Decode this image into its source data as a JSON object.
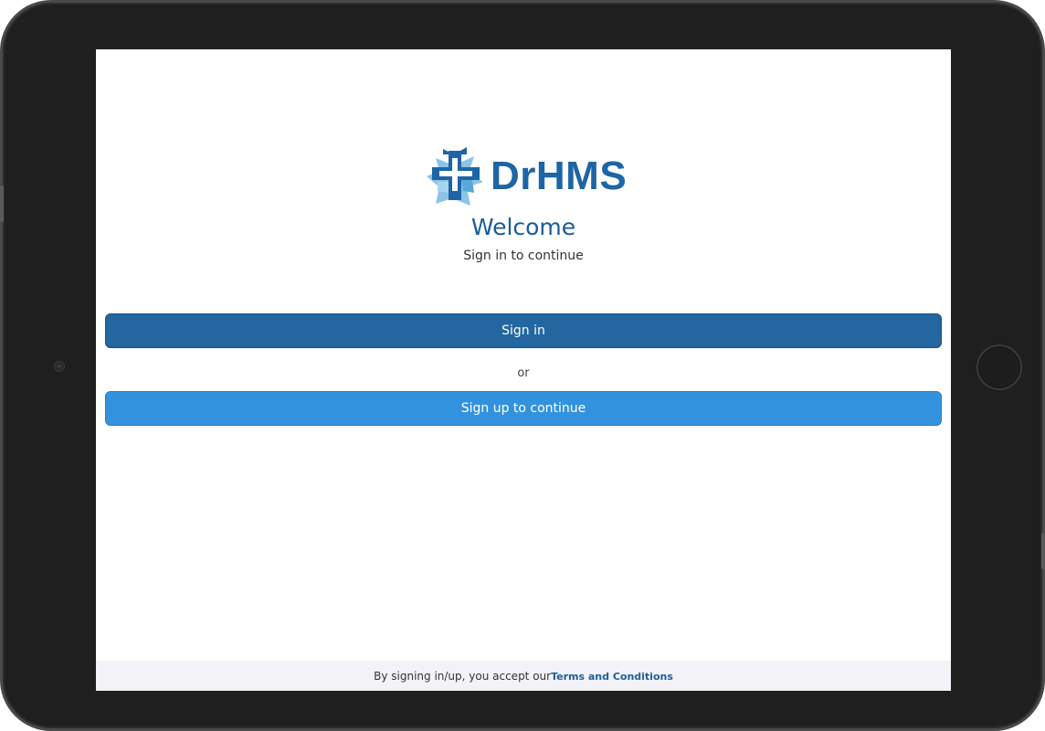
{
  "app": {
    "logo_text": "DrHMS"
  },
  "header": {
    "title": "Welcome",
    "subtitle": "Sign in to continue"
  },
  "actions": {
    "sign_in_label": "Sign in",
    "separator_label": "or",
    "sign_up_label": "Sign up to continue"
  },
  "footer": {
    "text": "By signing in/up, you accept our",
    "terms_link_label": "Terms and Conditions"
  },
  "colors": {
    "brand_dark": "#1e65a6",
    "brand_light": "#8cc4e6",
    "sign_in_button": "#2366a0",
    "sign_up_button": "#3392de",
    "footer_background": "#f2f2f7"
  },
  "icons": {
    "logo_mark": "medical-cross-logo-icon",
    "camera": "front-camera-icon",
    "home_button": "home-button-icon"
  }
}
